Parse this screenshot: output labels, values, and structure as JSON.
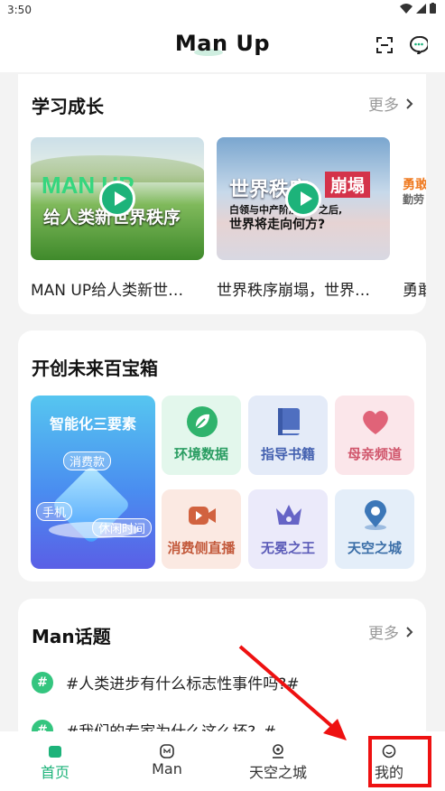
{
  "status": {
    "time": "3:50"
  },
  "header": {
    "title": "Man Up"
  },
  "learning": {
    "title": "学习成长",
    "more": "更多",
    "videos": [
      {
        "caption": "MAN UP给人类新世…",
        "thumb_big": "MAN UP",
        "thumb_sub": "给人类新世界秩序"
      },
      {
        "caption": "世界秩序崩塌，世界…",
        "thumb_big": "世界秩序",
        "thumb_tag": "崩塌",
        "thumb_line1": "白领与中产阶层破产之后,",
        "thumb_line2": "世界将走向何方?"
      },
      {
        "caption": "勇敢",
        "thumb_big": "勇敢",
        "thumb_sub": "勤劳"
      }
    ]
  },
  "toolbox": {
    "title": "开创未来百宝箱",
    "feature": {
      "title": "智能化三要素",
      "tags": [
        "消费款",
        "手机",
        "休闲时间"
      ]
    },
    "tiles": [
      {
        "label": "环境数据",
        "icon": "leaf-icon",
        "color": "#2a9d62",
        "bg": "#e3f7ec"
      },
      {
        "label": "指导书籍",
        "icon": "book-icon",
        "color": "#4461b0",
        "bg": "#e4ebf8"
      },
      {
        "label": "母亲频道",
        "icon": "heart-icon",
        "color": "#d0556b",
        "bg": "#fbe6ea"
      },
      {
        "label": "消费侧直播",
        "icon": "video-camera-icon",
        "color": "#c35a3c",
        "bg": "#fbe9e2"
      },
      {
        "label": "无冕之王",
        "icon": "crown-icon",
        "color": "#5b5bb8",
        "bg": "#ebeafa"
      },
      {
        "label": "天空之城",
        "icon": "location-pin-icon",
        "color": "#3c6fa8",
        "bg": "#e4eef9"
      }
    ]
  },
  "topics": {
    "title": "Man话题",
    "more": "更多",
    "items": [
      "#人类进步有什么标志性事件吗?#",
      "#我们的专家为什么这么坏?_#"
    ]
  },
  "tabbar": {
    "items": [
      {
        "label": "首页",
        "active": true
      },
      {
        "label": "Man",
        "active": false
      },
      {
        "label": "天空之城",
        "active": false
      },
      {
        "label": "我的",
        "active": false
      }
    ],
    "active_color": "#1db37a"
  }
}
